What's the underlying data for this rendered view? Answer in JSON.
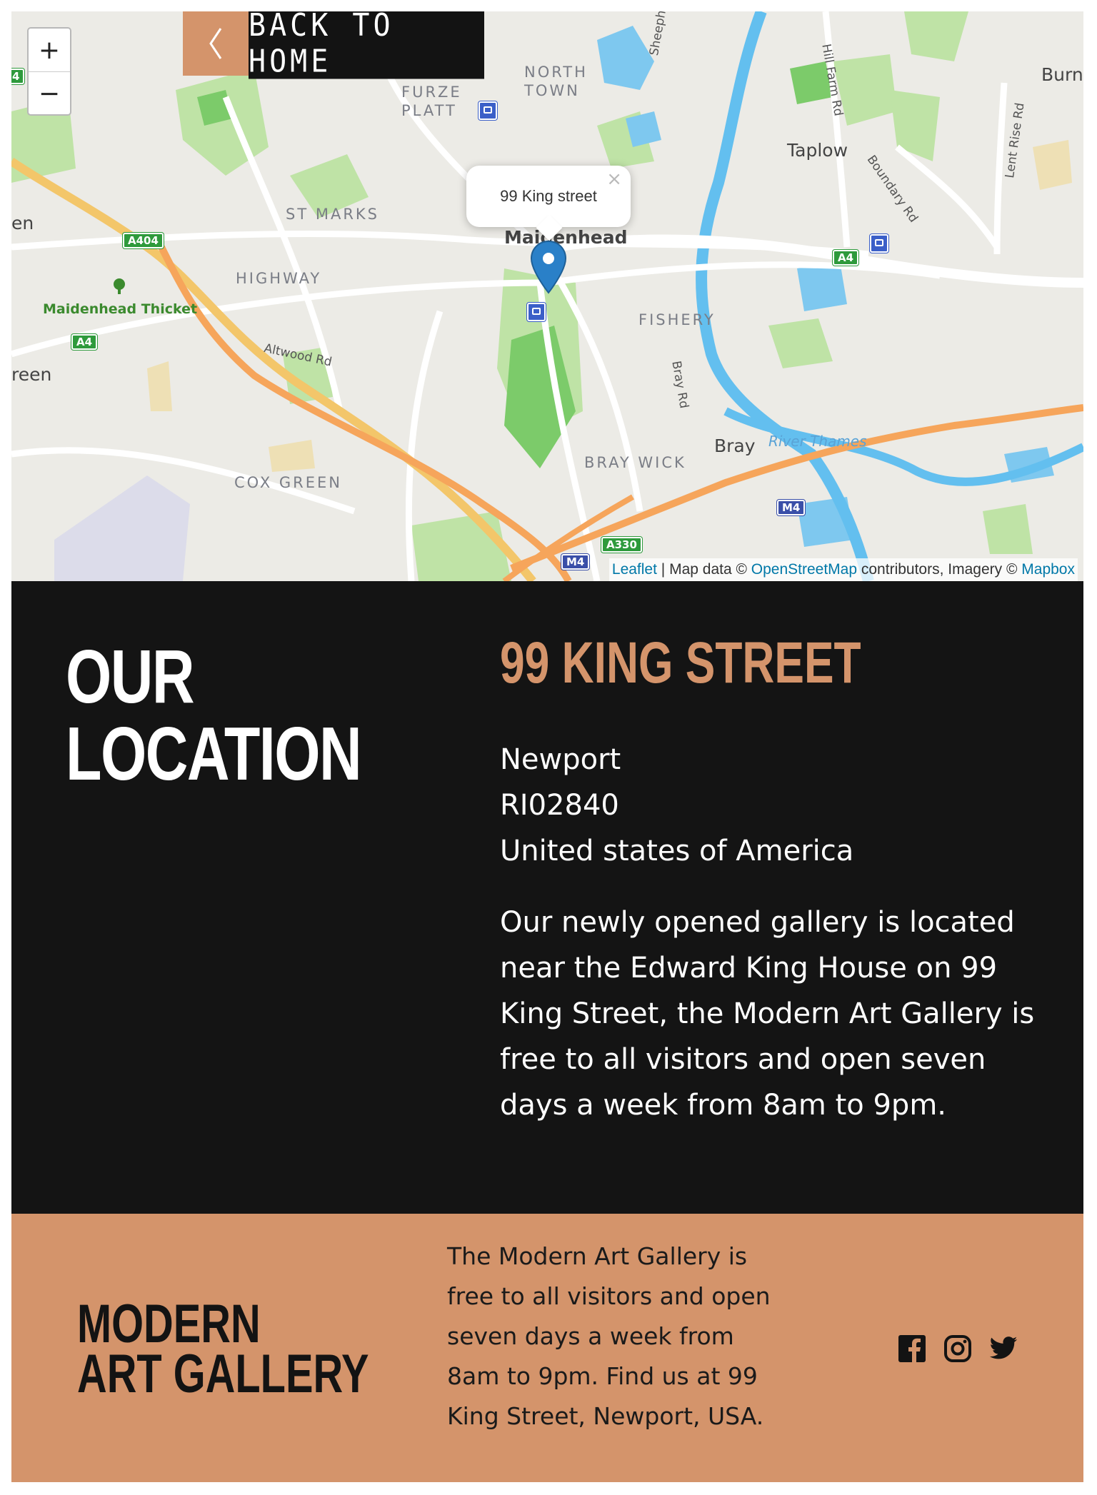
{
  "map": {
    "zoom_in": "+",
    "zoom_out": "−",
    "back_button": "BACK TO HOME",
    "popup": "99 King street",
    "places": {
      "north_town": "NORTH\nTOWN",
      "furze_platt": "FURZE\nPLATT",
      "st_marks": "ST MARKS",
      "highway": "HIGHWAY",
      "fishery": "FISHERY",
      "bray_wick": "BRAY WICK",
      "cox_green": "COX GREEN",
      "maidenhead": "Maidenhead",
      "taplow": "Taplow",
      "bray": "Bray",
      "burn": "Burn",
      "en": "en",
      "reen": "reen"
    },
    "roads": {
      "sheephouse": "Sheephouse",
      "hill_farm": "Hill Farm Rd",
      "boundary": "Boundary Rd",
      "lent_rise": "Lent Rise Rd",
      "altwood": "Altwood Rd",
      "bray_rd": "Bray Rd"
    },
    "water": "River Thames",
    "park": "Maidenhead Thicket",
    "shields": {
      "a404": "A404",
      "a4_west": "A4",
      "a4_east": "A4",
      "a4_left": "4",
      "a330": "A330",
      "m4_east": "M4",
      "m4_south": "M4"
    },
    "attribution": {
      "leaflet": "Leaflet",
      "sep": " | Map data © ",
      "osm": "OpenStreetMap",
      "mid": " contributors, Imagery © ",
      "mapbox": "Mapbox"
    }
  },
  "location": {
    "heading_line1": "OUR",
    "heading_line2": "LOCATION",
    "address_title": "99 KING STREET",
    "address_lines": [
      "Newport",
      "RI02840",
      "United states of America"
    ],
    "description": "Our newly opened gallery is located near the Edward King House on 99 King Street, the Modern Art Gallery is free to all visitors and open seven days a week from 8am to 9pm."
  },
  "footer": {
    "brand_line1": "MODERN",
    "brand_line2": "ART GALLERY",
    "text": "The Modern Art Gallery is free to all visitors and open seven days a week from 8am to 9pm. Find us at 99 King Street, Newport, USA.",
    "social": [
      "facebook-icon",
      "instagram-icon",
      "twitter-icon"
    ]
  },
  "colors": {
    "accent": "#d4946b",
    "dark": "#141414",
    "marker": "#2a80c8",
    "link": "#0078a8"
  }
}
